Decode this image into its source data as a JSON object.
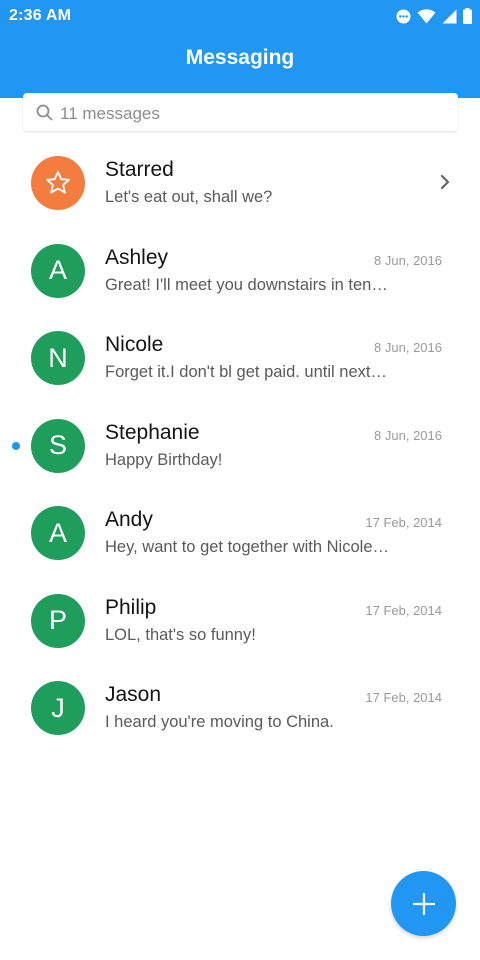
{
  "status_bar": {
    "time": "2:36 AM",
    "icons": [
      "notification-dots-icon",
      "wifi-icon",
      "cellular-signal-icon",
      "battery-icon"
    ]
  },
  "app": {
    "title": "Messaging"
  },
  "search": {
    "label": "11 messages",
    "icon": "search-icon"
  },
  "conversations": [
    {
      "avatar": "star-icon",
      "name": "Starred",
      "preview": "Let's eat out, shall we?",
      "date": "",
      "unread": false,
      "has_chevron": true
    },
    {
      "avatar": "A",
      "name": "Ashley",
      "preview": "Great! I'll meet you downstairs in ten minutes",
      "date": "8 Jun, 2016",
      "unread": false
    },
    {
      "avatar": "N",
      "name": "Nicole",
      "preview": "Forget it.I don't bl get paid. until next week",
      "date": "8 Jun, 2016",
      "unread": false
    },
    {
      "avatar": "S",
      "name": "Stephanie",
      "preview": "Happy Birthday!",
      "date": "8 Jun, 2016",
      "unread": true
    },
    {
      "avatar": "A",
      "name": "Andy",
      "preview": "Hey, want to get together with Nicole tonight?",
      "date": "17 Feb, 2014",
      "unread": false
    },
    {
      "avatar": "P",
      "name": "Philip",
      "preview": "LOL, that's so funny!",
      "date": "17 Feb, 2014",
      "unread": false
    },
    {
      "avatar": "J",
      "name": "Jason",
      "preview": "I heard you're moving to China.",
      "date": "17 Feb, 2014",
      "unread": false
    }
  ],
  "fab": {
    "icon": "plus-icon"
  },
  "colors": {
    "primary": "#2196F3",
    "avatar_green": "#1e9e5a",
    "starred_orange": "#F57C3F"
  }
}
